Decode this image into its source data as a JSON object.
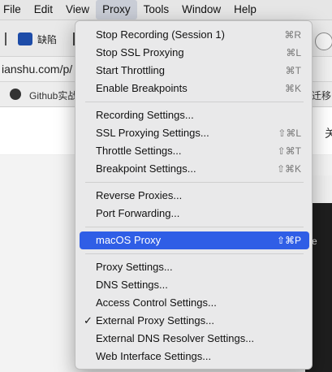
{
  "menubar": {
    "items": [
      "File",
      "Edit",
      "View",
      "Proxy",
      "Tools",
      "Window",
      "Help"
    ]
  },
  "toolbar": {
    "ext_label": "缺陷"
  },
  "urlbar": {
    "url": "ianshu.com/p/"
  },
  "bookmarks": {
    "github_label": "Github实战",
    "right_label": "迁移"
  },
  "page": {
    "top_right_char": "关",
    "dark_panel_char": "e"
  },
  "proxy_menu": {
    "groups": [
      [
        {
          "label": "Stop Recording (Session 1)",
          "shortcut": "⌘R"
        },
        {
          "label": "Stop SSL Proxying",
          "shortcut": "⌘L"
        },
        {
          "label": "Start Throttling",
          "shortcut": "⌘T"
        },
        {
          "label": "Enable Breakpoints",
          "shortcut": "⌘K"
        }
      ],
      [
        {
          "label": "Recording Settings...",
          "shortcut": ""
        },
        {
          "label": "SSL Proxying Settings...",
          "shortcut": "⇧⌘L"
        },
        {
          "label": "Throttle Settings...",
          "shortcut": "⇧⌘T"
        },
        {
          "label": "Breakpoint Settings...",
          "shortcut": "⇧⌘K"
        }
      ],
      [
        {
          "label": "Reverse Proxies...",
          "shortcut": ""
        },
        {
          "label": "Port Forwarding...",
          "shortcut": ""
        }
      ],
      [
        {
          "label": "macOS Proxy",
          "shortcut": "⇧⌘P",
          "highlighted": true
        }
      ],
      [
        {
          "label": "Proxy Settings...",
          "shortcut": ""
        },
        {
          "label": "DNS Settings...",
          "shortcut": ""
        },
        {
          "label": "Access Control Settings...",
          "shortcut": ""
        },
        {
          "label": "External Proxy Settings...",
          "shortcut": "",
          "checked": true,
          "check_mark": "✓"
        },
        {
          "label": "External DNS Resolver Settings...",
          "shortcut": ""
        },
        {
          "label": "Web Interface Settings...",
          "shortcut": ""
        }
      ]
    ]
  },
  "colors": {
    "highlight": "#2f5ee6",
    "menu_bg": "#e9e9ea"
  }
}
